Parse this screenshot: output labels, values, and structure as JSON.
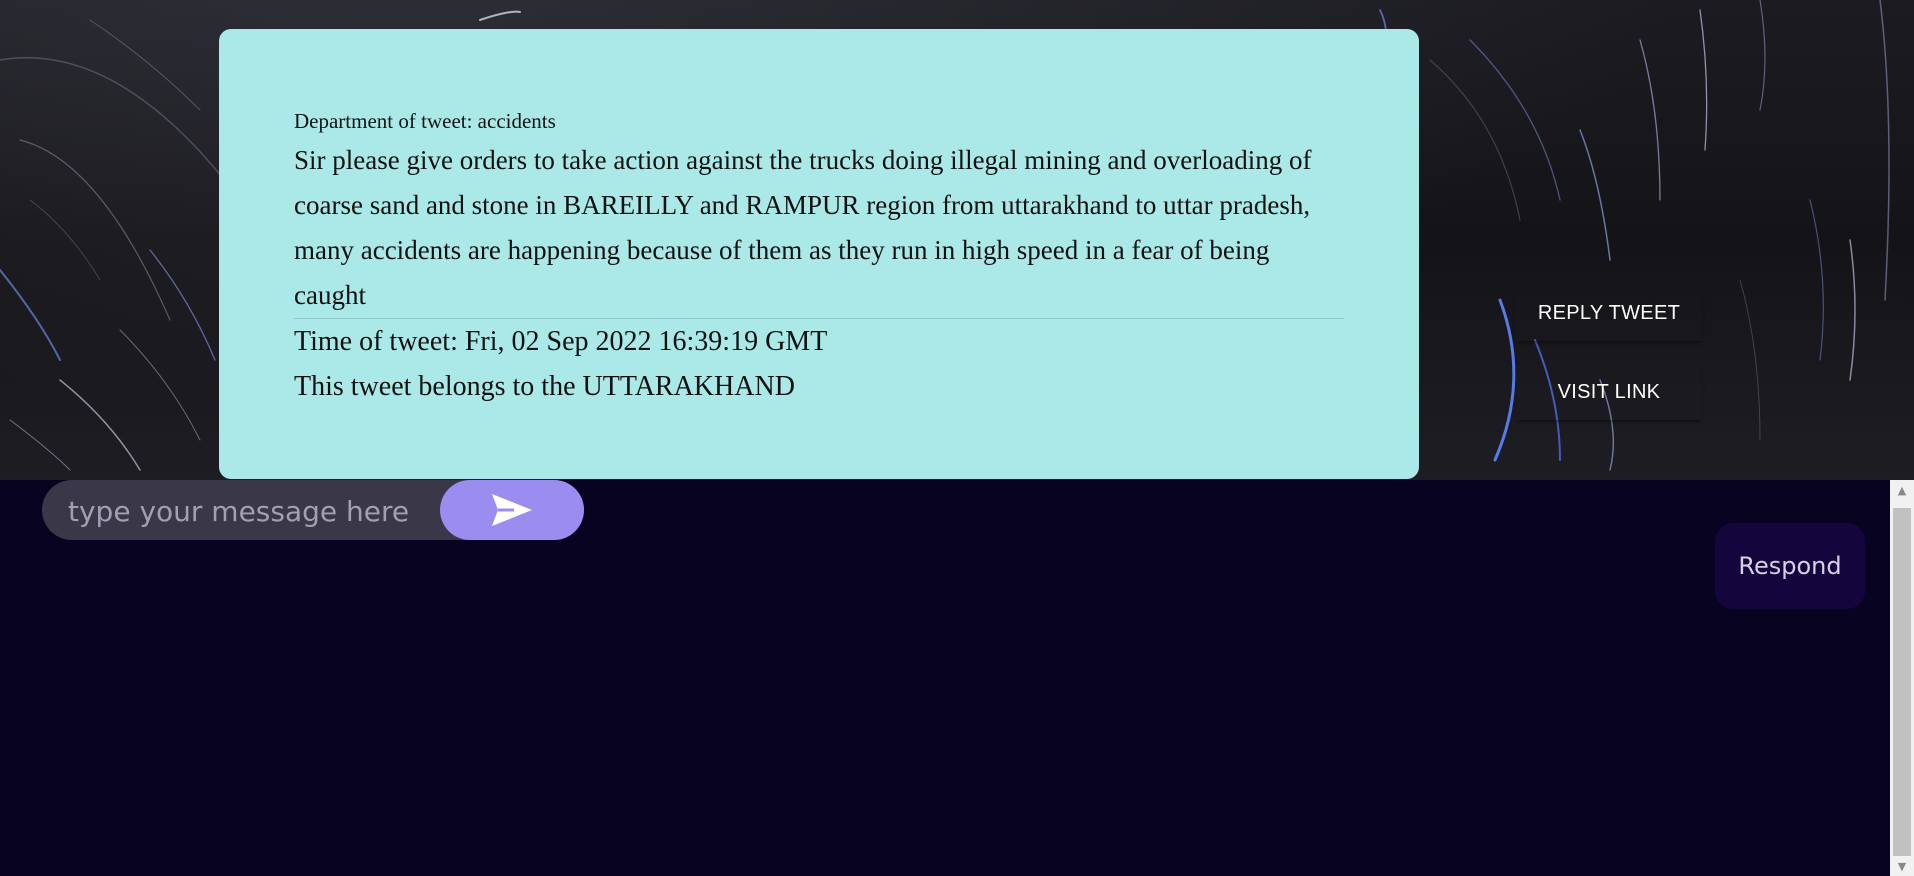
{
  "tweet": {
    "department_text": "Department of tweet: accidents",
    "body": "Sir please give orders to take action against the trucks doing illegal mining and overloading of coarse sand and stone in BAREILLY and RAMPUR region from uttarakhand to uttar pradesh, many accidents are happening because of them as they run in high speed in a fear of being caught",
    "time_text": "Time of tweet: Fri, 02 Sep 2022 16:39:19 GMT",
    "region_text": "This tweet belongs to the UTTARAKHAND"
  },
  "actions": {
    "reply_label": "REPLY TWEET",
    "visit_label": "VISIT LINK"
  },
  "composer": {
    "placeholder": "type your message here",
    "value": "",
    "send_icon": "send-icon"
  },
  "respond_label": "Respond",
  "colors": {
    "card": "#abe9e8",
    "page_bg": "#070321",
    "send_button": "#9b8cf0",
    "respond_button": "#14063d"
  }
}
